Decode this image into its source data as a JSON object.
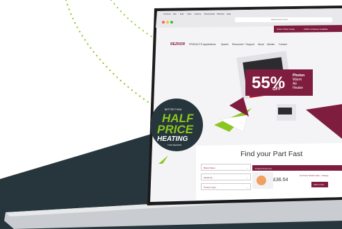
{
  "browser": {
    "menu_items": [
      "Chrome",
      "File",
      "Edit",
      "View",
      "History",
      "Bookmarks",
      "Window",
      "Help"
    ],
    "url": "www.reznor.co.uk"
  },
  "site": {
    "brand": "REZNOR",
    "nav_items": [
      "PRODUCTS",
      "Applications",
      "Spares",
      "Resources + Support",
      "About",
      "Articles",
      "Contact"
    ],
    "top_pills": [
      "Order Online Today",
      "1000s of Spares Available"
    ]
  },
  "promo": {
    "percent": "55%",
    "off": "OFF",
    "product_lines": [
      "Photon",
      "Warm",
      "Air",
      "Heater"
    ]
  },
  "badge": {
    "top": "BETTER THAN",
    "line1": "HALF",
    "line2": "PRICE",
    "line3": "HEATING",
    "bottom": "THIS SEASON"
  },
  "finder": {
    "title": "Find your Part Fast",
    "fields": [
      "Brand Name",
      "Model No.",
      "Product Type"
    ],
    "product_strip_label": "Product Parts List",
    "price": "£36.54",
    "product_name": "Air Press Switch Hole - Orange",
    "cart_label": "Add to Cart"
  },
  "colors": {
    "accent_maroon": "#7f1d3f",
    "accent_lime": "#8bc61e",
    "dark_slate": "#27363c",
    "screen_bg": "#f4f4f6"
  }
}
